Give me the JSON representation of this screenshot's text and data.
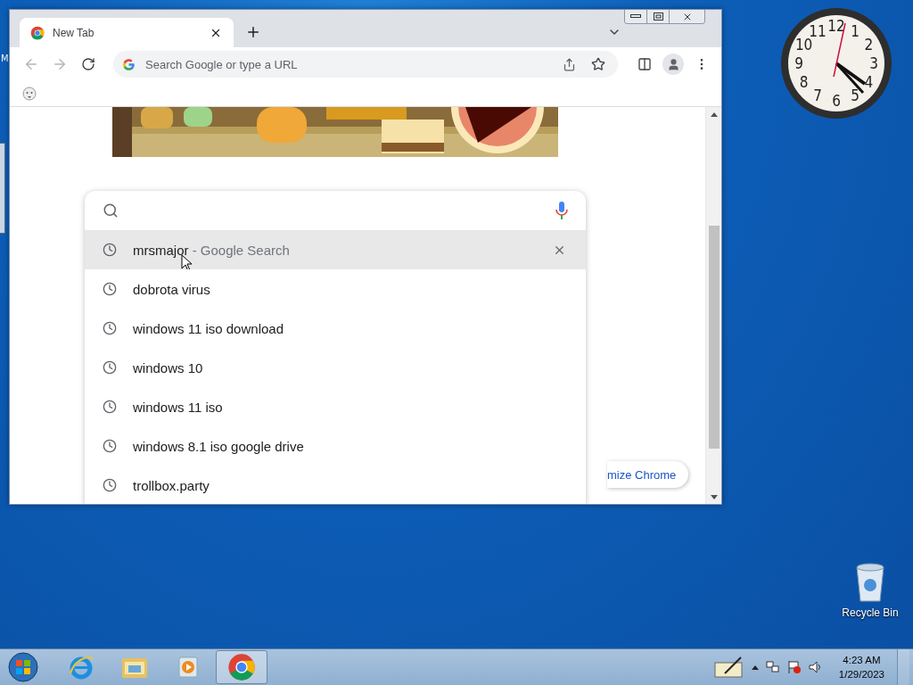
{
  "desktop": {
    "behind_window_letter": "M",
    "recycle_bin": {
      "label": "Recycle Bin"
    },
    "clock": {
      "numerals": [
        "11",
        "12",
        "1",
        "10",
        "2",
        "9",
        "3",
        "8",
        "4",
        "7",
        "6",
        "5"
      ]
    }
  },
  "browser": {
    "tabs": [
      {
        "title": "New Tab",
        "selected": true
      }
    ],
    "omnibox": {
      "placeholder": "Search Google or type a URL"
    },
    "page": {
      "search": {
        "suggestions": [
          {
            "text": "mrsmajor",
            "suffix": " - Google Search",
            "selected": true
          },
          {
            "text": "dobrota virus",
            "selected": false
          },
          {
            "text": "windows 11 iso download",
            "selected": false
          },
          {
            "text": "windows 10",
            "selected": false
          },
          {
            "text": "windows 11 iso",
            "selected": false
          },
          {
            "text": "windows 8.1 iso google drive",
            "selected": false
          },
          {
            "text": "trollbox.party",
            "selected": false
          }
        ]
      },
      "customize_button": "mize Chrome"
    }
  },
  "taskbar": {
    "apps": [
      {
        "kind": "ie",
        "active": false
      },
      {
        "kind": "explorer",
        "active": false
      },
      {
        "kind": "media",
        "active": false
      },
      {
        "kind": "chrome",
        "active": true
      }
    ],
    "time": "4:23 AM",
    "date": "1/29/2023"
  }
}
